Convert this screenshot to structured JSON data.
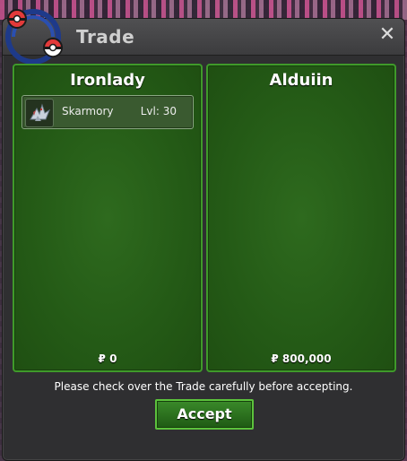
{
  "window": {
    "title": "Trade",
    "close_icon": "close-icon",
    "logo_icon": "pokeball-logo-icon"
  },
  "left_panel": {
    "player_name": "Ironlady",
    "items": [
      {
        "icon": "skarmory-icon",
        "name": "Skarmory",
        "level": "Lvl: 30"
      }
    ],
    "money": "₽ 0"
  },
  "right_panel": {
    "player_name": "Alduiin",
    "items": [],
    "money": "₽ 800,000"
  },
  "footer": {
    "notice": "Please check over the Trade carefully before accepting.",
    "accept_label": "Accept"
  },
  "colors": {
    "panel_green": "#245a16",
    "panel_border": "#3f9a2a",
    "button_green": "#3a8a2a",
    "window_bg": "#2f2f31"
  }
}
